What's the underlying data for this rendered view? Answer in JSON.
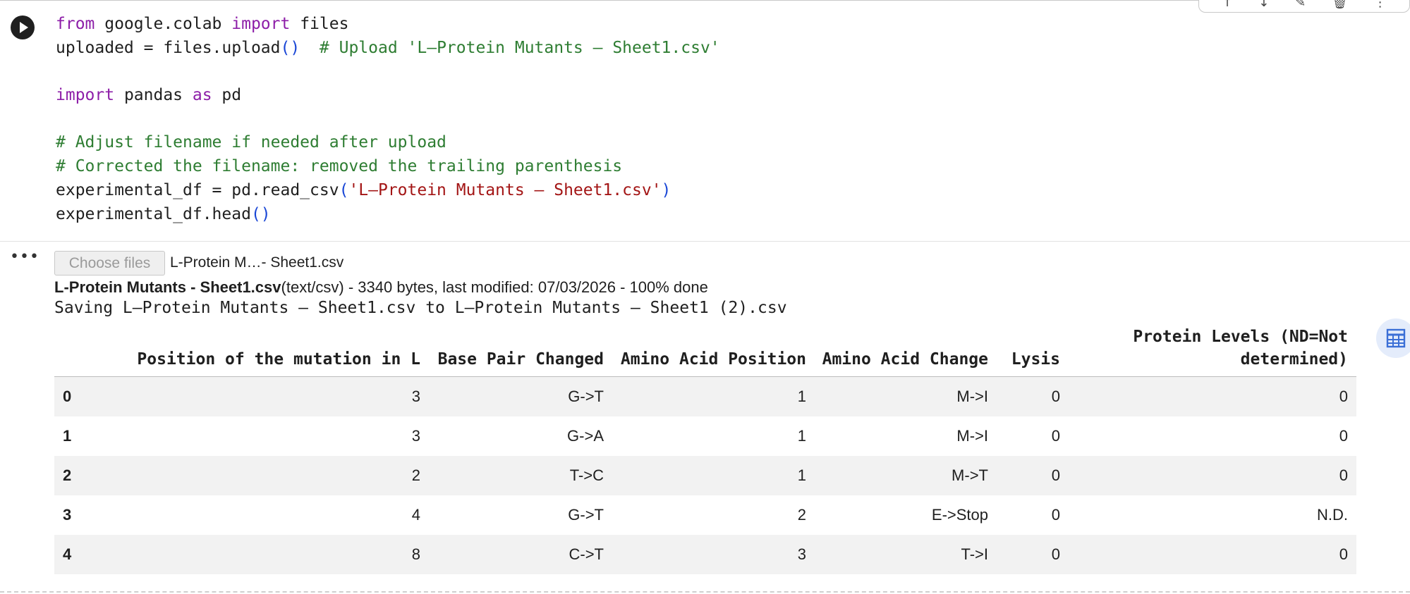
{
  "cell_toolbar": {
    "icons": [
      "arrow-up-icon",
      "arrow-down-icon",
      "pencil-icon",
      "delete-icon",
      "more-vert-icon"
    ],
    "glyphs": [
      "↑",
      "↓",
      "✎",
      "🗑",
      "⋮"
    ]
  },
  "code_lines": [
    [
      {
        "t": "from",
        "c": "kw"
      },
      {
        "t": " google.colab "
      },
      {
        "t": "import",
        "c": "kw"
      },
      {
        "t": " files"
      }
    ],
    [
      {
        "t": "uploaded = files.upload"
      },
      {
        "t": "()",
        "c": "pr"
      },
      {
        "t": "  "
      },
      {
        "t": "# Upload 'L–Protein Mutants – Sheet1.csv'",
        "c": "cm"
      }
    ],
    [],
    [
      {
        "t": "import",
        "c": "kw"
      },
      {
        "t": " pandas "
      },
      {
        "t": "as",
        "c": "kw"
      },
      {
        "t": " pd"
      }
    ],
    [],
    [
      {
        "t": "# Adjust filename if needed after upload",
        "c": "cm"
      }
    ],
    [
      {
        "t": "# Corrected the filename: removed the trailing parenthesis",
        "c": "cm"
      }
    ],
    [
      {
        "t": "experimental_df = pd.read_csv"
      },
      {
        "t": "(",
        "c": "pr"
      },
      {
        "t": "'L–Protein Mutants – Sheet1.csv'",
        "c": "st"
      },
      {
        "t": ")",
        "c": "pr"
      }
    ],
    [
      {
        "t": "experimental_df.head"
      },
      {
        "t": "()",
        "c": "pr"
      }
    ]
  ],
  "output": {
    "menu_glyph": "•••",
    "choose_files_label": "Choose files",
    "chosen_file": "L-Protein M…- Sheet1.csv",
    "upload_filename": "L-Protein Mutants - Sheet1.csv",
    "upload_details": "(text/csv) - 3340 bytes, last modified: 07/03/2026 - 100% done",
    "saving_line": "Saving L–Protein Mutants – Sheet1.csv to L–Protein Mutants – Sheet1 (2).csv"
  },
  "table": {
    "columns": [
      "",
      "Position of the mutation in L",
      "Base Pair Changed",
      "Amino Acid Position",
      "Amino Acid Change",
      "Lysis",
      "Protein Levels (ND=Not determined)"
    ],
    "rows": [
      [
        "0",
        "3",
        "G->T",
        "1",
        "M->I",
        "0",
        "0"
      ],
      [
        "1",
        "3",
        "G->A",
        "1",
        "M->I",
        "0",
        "0"
      ],
      [
        "2",
        "2",
        "T->C",
        "1",
        "M->T",
        "0",
        "0"
      ],
      [
        "3",
        "4",
        "G->T",
        "2",
        "E->Stop",
        "0",
        "N.D."
      ],
      [
        "4",
        "8",
        "C->T",
        "3",
        "T->I",
        "0",
        "0"
      ]
    ]
  }
}
